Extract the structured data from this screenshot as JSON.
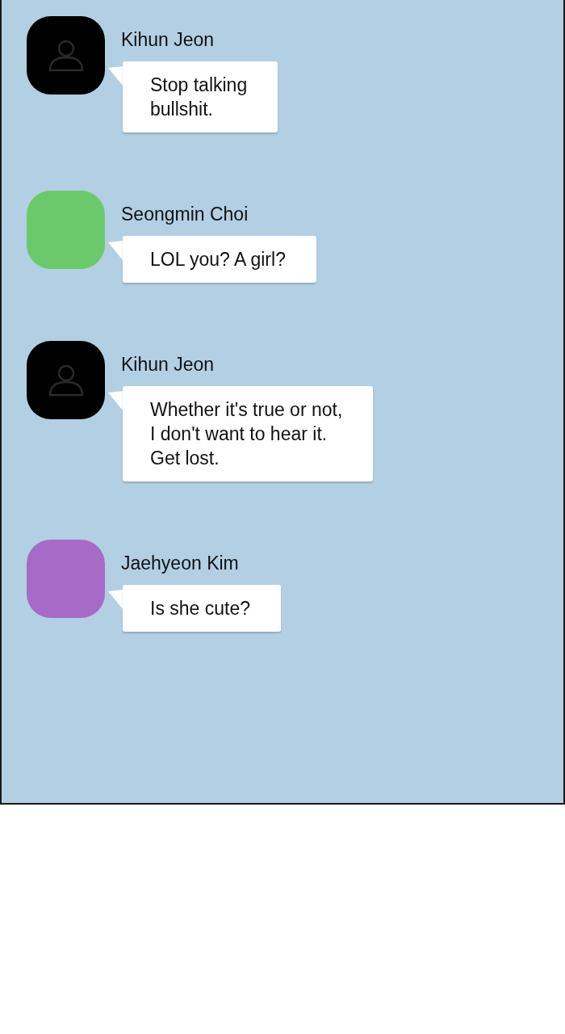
{
  "messages": [
    {
      "sender": "Kihun Jeon",
      "avatar": {
        "kind": "silhouette",
        "color": "#000000"
      },
      "text": "Stop talking\nbullshit."
    },
    {
      "sender": "Seongmin Choi",
      "avatar": {
        "kind": "plain",
        "color": "#6bc96b"
      },
      "text": "LOL you? A girl?"
    },
    {
      "sender": "Kihun Jeon",
      "avatar": {
        "kind": "silhouette",
        "color": "#000000"
      },
      "text": "Whether it's true or not,\nI don't want to hear it.\nGet lost."
    },
    {
      "sender": "Jaehyeon Kim",
      "avatar": {
        "kind": "plain",
        "color": "#a66bc6"
      },
      "text": "Is she cute?"
    }
  ]
}
